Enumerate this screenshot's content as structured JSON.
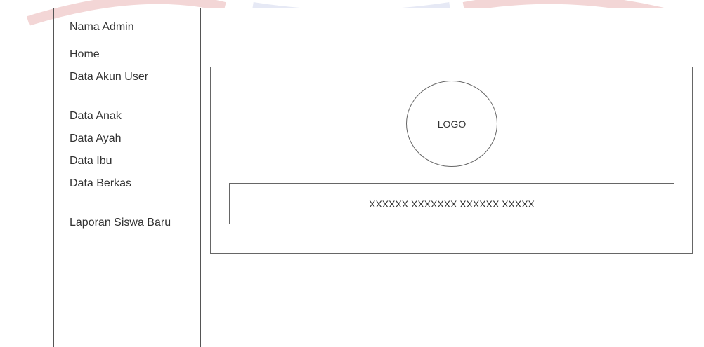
{
  "sidebar": {
    "admin_name": "Nama Admin",
    "menu": {
      "home": "Home",
      "data_akun_user": "Data Akun User",
      "data_anak": "Data Anak",
      "data_ayah": "Data Ayah",
      "data_ibu": "Data Ibu",
      "data_berkas": "Data Berkas",
      "laporan_siswa_baru": "Laporan Siswa Baru"
    }
  },
  "main": {
    "logo_label": "LOGO",
    "placeholder_text": "XXXXXX XXXXXXX XXXXXX XXXXX"
  }
}
